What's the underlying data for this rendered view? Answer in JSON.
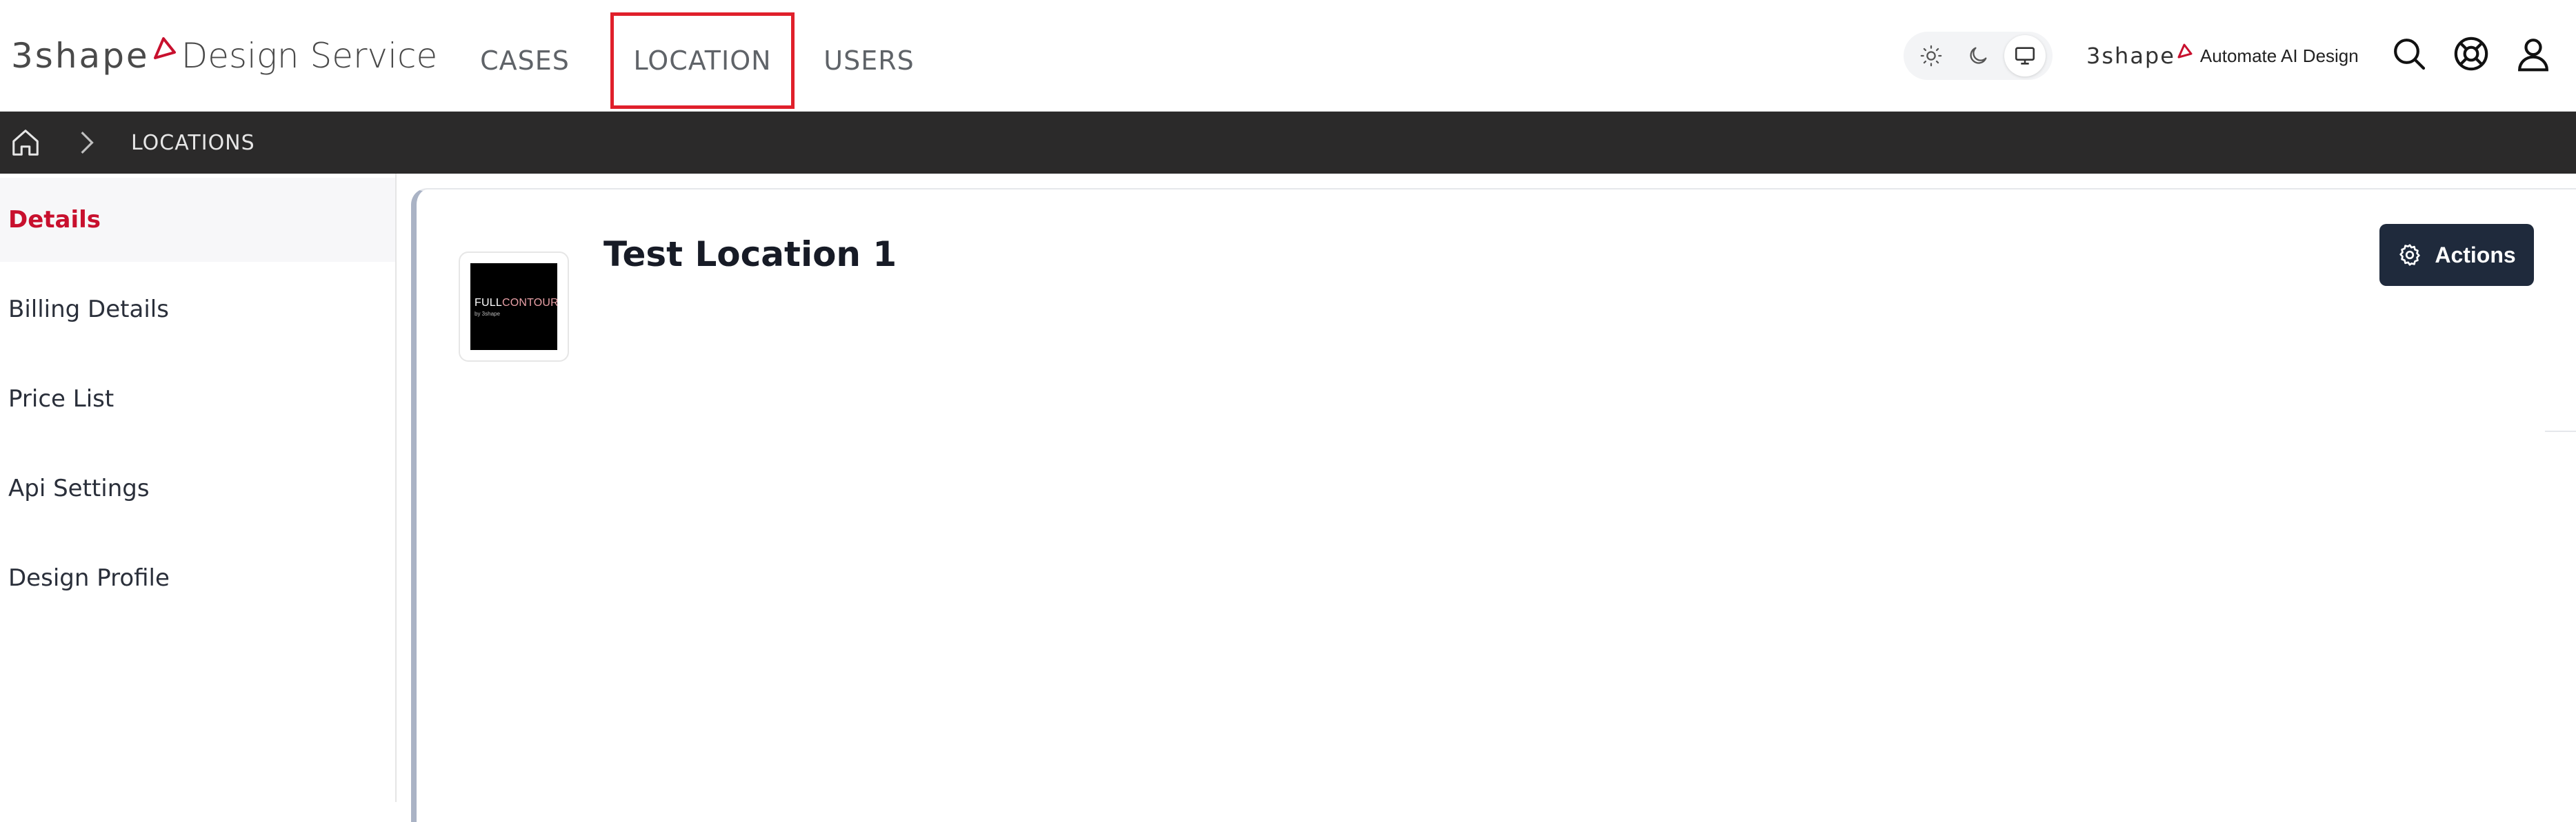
{
  "header": {
    "brand_prefix": "3shape",
    "brand_name": "Design Service",
    "nav": [
      {
        "label": "CASES"
      },
      {
        "label": "LOCATION"
      },
      {
        "label": "USERS"
      }
    ],
    "theme_modes": [
      "sun-icon",
      "moon-icon",
      "monitor-icon"
    ],
    "active_theme": "monitor-icon",
    "ai_brand_prefix": "3shape",
    "ai_brand_text": "Automate AI Design",
    "icons": [
      "search-icon",
      "help-icon",
      "user-icon"
    ]
  },
  "breadcrumb": {
    "home_icon": "home-icon",
    "separator_icon": "chevron-right-icon",
    "current": "LOCATIONS"
  },
  "sidebar": {
    "items": [
      {
        "label": "Details"
      },
      {
        "label": "Billing Details"
      },
      {
        "label": "Price List"
      },
      {
        "label": "Api Settings"
      },
      {
        "label": "Design Profile"
      }
    ],
    "active_index": 0
  },
  "main": {
    "title": "Test Location 1",
    "logo": {
      "text_full": "FULL",
      "text_contour": "CONTOUR",
      "text_by": "by 3shape"
    },
    "actions_label": "Actions",
    "actions_icon": "gear-icon"
  },
  "colors": {
    "accent": "#c8102e",
    "highlight_box": "#e0202b",
    "breadcrumb_bg": "#2b2a2a",
    "actions_bg": "#1f2a3c"
  }
}
